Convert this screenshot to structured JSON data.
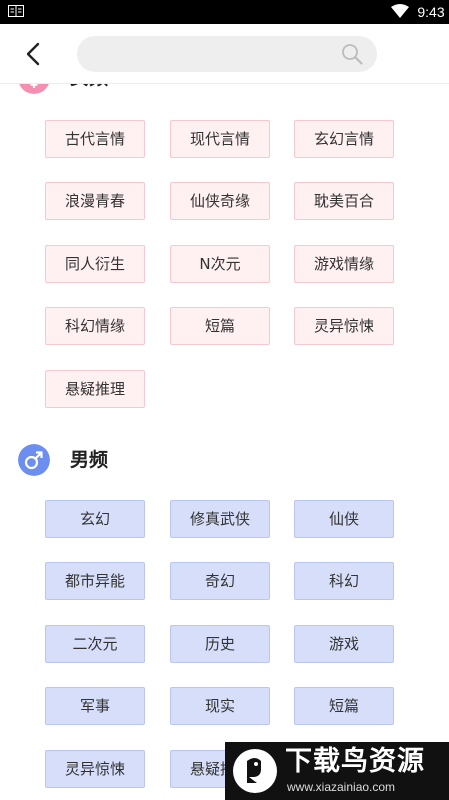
{
  "status_bar": {
    "time": "9:43"
  },
  "search": {
    "placeholder": ""
  },
  "female_section": {
    "title": "女频",
    "icon": "female-symbol-icon",
    "color": "#f48fb1",
    "tags": [
      "古代言情",
      "现代言情",
      "玄幻言情",
      "浪漫青春",
      "仙侠奇缘",
      "耽美百合",
      "同人衍生",
      "N次元",
      "游戏情缘",
      "科幻情缘",
      "短篇",
      "灵异惊悚",
      "悬疑推理"
    ]
  },
  "male_section": {
    "title": "男频",
    "icon": "male-symbol-icon",
    "color": "#6b8ef0",
    "tags": [
      "玄幻",
      "修真武侠",
      "仙侠",
      "都市异能",
      "奇幻",
      "科幻",
      "二次元",
      "历史",
      "游戏",
      "军事",
      "现实",
      "短篇",
      "灵异惊悚",
      "悬疑推理"
    ]
  },
  "watermark": {
    "title": "下载鸟资源",
    "url": "www.xiazainiao.com"
  }
}
